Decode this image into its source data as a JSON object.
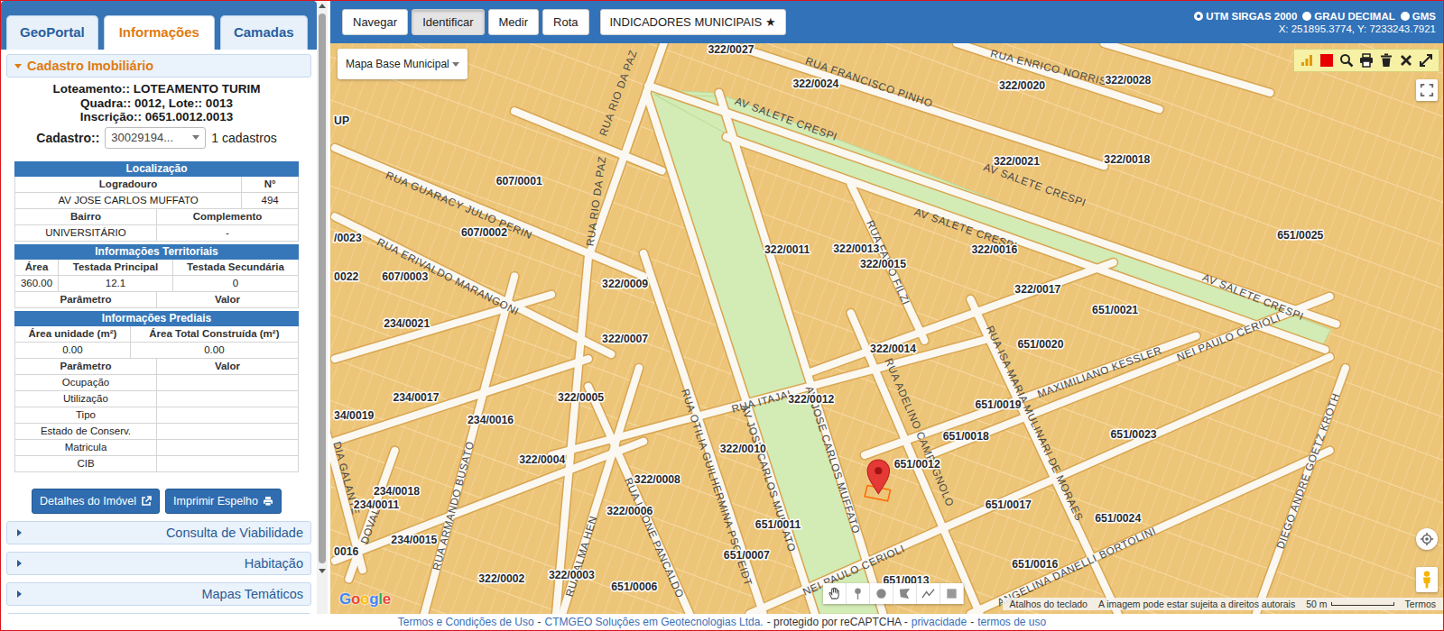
{
  "left_panel": {
    "tabs": [
      {
        "label": "GeoPortal",
        "selected": false
      },
      {
        "label": "Informações",
        "selected": true
      },
      {
        "label": "Camadas",
        "selected": false
      }
    ],
    "section": {
      "title": "Cadastro Imobiliário",
      "expanded": true
    },
    "summary": [
      "Loteamento:: LOTEAMENTO TURIM",
      "Quadra:: 0012, Lote:: 0013",
      "Inscrição:: 0651.0012.0013"
    ],
    "cadastro": {
      "label": "Cadastro::",
      "value": "30029194...",
      "count": "1 cadastros"
    },
    "tables": [
      {
        "title": "Localização",
        "rows": [
          {
            "kind": "head",
            "cells": [
              "Logradouro",
              "N°"
            ]
          },
          {
            "kind": "value",
            "cells": [
              "AV JOSE CARLOS MUFFATO",
              "494"
            ]
          },
          {
            "kind": "head",
            "cells": [
              "Bairro",
              "Complemento"
            ]
          },
          {
            "kind": "value",
            "cells": [
              "UNIVERSITÁRIO",
              "-"
            ]
          }
        ]
      },
      {
        "title": "Informações Territoriais",
        "rows": [
          {
            "kind": "head",
            "cells": [
              "Área",
              "Testada Principal",
              "Testada Secundária"
            ]
          },
          {
            "kind": "value",
            "cells": [
              "360.00",
              "12.1",
              "0"
            ]
          },
          {
            "kind": "head",
            "cells": [
              "Parâmetro",
              "Valor"
            ]
          }
        ]
      },
      {
        "title": "Informações Prediais",
        "rows": [
          {
            "kind": "head",
            "cells": [
              "Área unidade (m²)",
              "Área Total Construída (m²)"
            ]
          },
          {
            "kind": "value",
            "cells": [
              "0.00",
              "0.00"
            ]
          },
          {
            "kind": "head",
            "cells": [
              "Parâmetro",
              "Valor"
            ]
          },
          {
            "kind": "value",
            "cells": [
              "Ocupação",
              ""
            ]
          },
          {
            "kind": "value",
            "cells": [
              "Utilização",
              ""
            ]
          },
          {
            "kind": "value",
            "cells": [
              "Tipo",
              ""
            ]
          },
          {
            "kind": "value",
            "cells": [
              "Estado de Conserv.",
              ""
            ]
          },
          {
            "kind": "value",
            "cells": [
              "Matricula",
              ""
            ]
          },
          {
            "kind": "value",
            "cells": [
              "CIB",
              ""
            ]
          }
        ]
      }
    ],
    "buttons": [
      "Detalhes do Imóvel",
      "Imprimir Espelho"
    ],
    "accordions": [
      {
        "title": "Consulta de Viabilidade",
        "expanded": false
      },
      {
        "title": "Habitação",
        "expanded": false
      },
      {
        "title": "Mapas Temáticos",
        "expanded": false
      }
    ]
  },
  "toolbar": {
    "tools": [
      {
        "label": "Navegar",
        "selected": false
      },
      {
        "label": "Identificar",
        "selected": true
      },
      {
        "label": "Medir",
        "selected": false
      },
      {
        "label": "Rota",
        "selected": false
      }
    ],
    "indicators": "INDICADORES MUNICIPAIS ★",
    "coord_systems": [
      {
        "label": "UTM SIRGAS 2000",
        "selected": true
      },
      {
        "label": "GRAU DECIMAL",
        "selected": false
      },
      {
        "label": "GMS",
        "selected": false
      }
    ],
    "coordinates": "X: 251895.3774, Y: 7233243.7921"
  },
  "map": {
    "base_layer": "Mapa Base Municipal",
    "street_labels": [
      "RUA FRANCISCO PINHO",
      "RUA ENRICO NORRIS",
      "AV SALETE CRESPI",
      "AV SALETE CRESPI",
      "AV SALETE CRESPI",
      "AV SALETE CRESPI",
      "RUA RIO DA PAZ",
      "RUA RIO DA PAZ",
      "RUA GUARACY JULIO PERIN",
      "RUA ERIVALDO MARANGONI",
      "RUA FABIO FILZI",
      "RUA ITAJAI",
      "AV JOSE CARLOS MUFFATO",
      "AV JOSE CARLOS MUFFATO",
      "RUA OTILIA GUILHERMINA PSCHEIDT",
      "RUA ADELINO CAMPAGNOLO",
      "RUA ISA MARIA MULINARI DE MORAES",
      "MAXIMILIANO KESSLER",
      "NEI PAULO CERIOLI",
      "NEI PAULO CERIOLI",
      "ANGELINA DANELLI BORTOLINI",
      "DIEGO ANDRE GOETZ KROTH",
      "RUA ARMANDO BUSATO",
      "RUA ALMA HEN",
      "RUA LEONE PANCALDO",
      "DIA GALANTE",
      "DOVAL"
    ],
    "lot_labels": [
      "322/0027",
      "322/0024",
      "322/0020",
      "322/0028",
      "UP",
      "322/0021",
      "322/0018",
      "607/0001",
      "607/0002",
      "/0023",
      "651/0025",
      "322/0011",
      "322/0013",
      "322/0016",
      "322/0015",
      "0022",
      "607/0003",
      "322/0009",
      "322/0017",
      "651/0021",
      "234/0021",
      "651/0020",
      "322/0007",
      "322/0014",
      "322/0012",
      "234/0017",
      "322/0005",
      "651/0019",
      "34/0019",
      "234/0016",
      "651/0018",
      "651/0023",
      "322/0004",
      "322/0010",
      "651/0012",
      "322/0008",
      "234/0018",
      "234/0011",
      "322/0006",
      "651/0017",
      "651/0024",
      "651/0011",
      "234/0015",
      "651/0007",
      "0016",
      "651/0016",
      "322/0002",
      "322/0003",
      "651/0006",
      "651/0013"
    ],
    "attribution": {
      "logo": "Google",
      "shortcuts": "Atalhos do teclado",
      "copyright": "A imagem pode estar sujeita a direitos autorais",
      "scale": "50 m",
      "terms": "Termos"
    }
  },
  "footer": [
    {
      "text": "Termos e Condições de Uso",
      "link": true
    },
    {
      "text": "-",
      "link": false
    },
    {
      "text": "CTMGEO Soluções em Geotecnologias Ltda.",
      "link": true
    },
    {
      "text": "- protegido por reCAPTCHA -",
      "link": false
    },
    {
      "text": "privacidade",
      "link": true
    },
    {
      "text": "-",
      "link": false
    },
    {
      "text": "termos de uso",
      "link": true
    }
  ]
}
